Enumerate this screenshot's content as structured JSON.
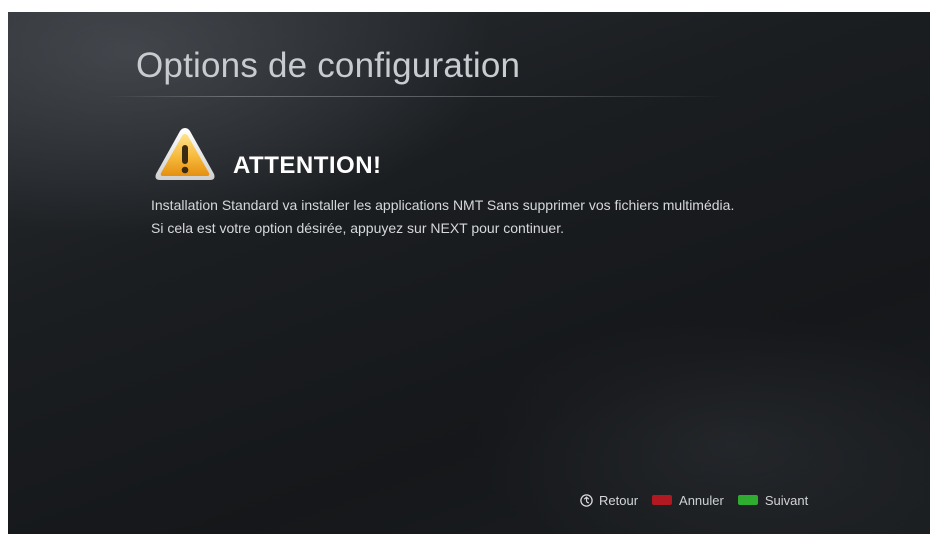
{
  "page": {
    "title": "Options de configuration"
  },
  "warning": {
    "icon": "warning-icon",
    "heading": "ATTENTION!",
    "lines": [
      "Installation Standard va installer les applications NMT Sans supprimer vos fichiers multimédia.",
      "Si cela est votre option désirée, appuyez sur NEXT pour continuer."
    ]
  },
  "footer": {
    "hints": [
      {
        "icon": "back-icon",
        "label": "Retour"
      },
      {
        "icon": "red-key-icon",
        "color": "#c0121b",
        "label": "Annuler"
      },
      {
        "icon": "green-key-icon",
        "color": "#2bbd2b",
        "label": "Suivant"
      }
    ]
  }
}
